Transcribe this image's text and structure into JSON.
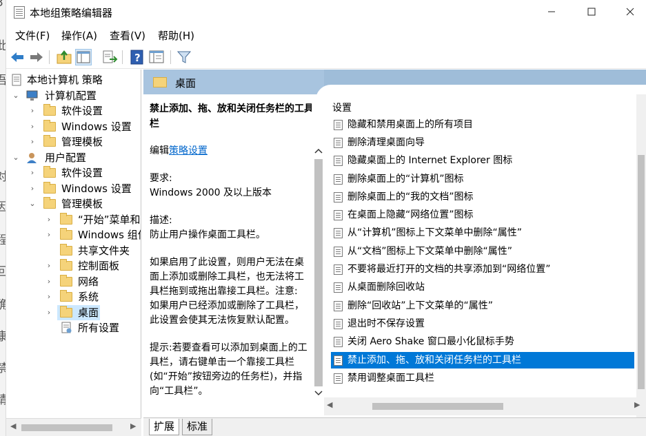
{
  "window": {
    "title": "本地组策略编辑器"
  },
  "menubar": [
    "文件(F)",
    "操作(A)",
    "查看(V)",
    "帮助(H)"
  ],
  "tree": [
    {
      "label": "本地计算机 策略",
      "chevron": ""
    },
    {
      "label": "计算机配置",
      "chevron": "⌄"
    },
    {
      "label": "软件设置",
      "chevron": "›"
    },
    {
      "label": "Windows 设置",
      "chevron": "›"
    },
    {
      "label": "管理模板",
      "chevron": "›"
    },
    {
      "label": "用户配置",
      "chevron": "⌄"
    },
    {
      "label": "软件设置",
      "chevron": "›"
    },
    {
      "label": "Windows 设置",
      "chevron": "›"
    },
    {
      "label": "管理模板",
      "chevron": "⌄"
    },
    {
      "label": "“开始”菜单和任",
      "chevron": "›"
    },
    {
      "label": "Windows 组件",
      "chevron": "›"
    },
    {
      "label": "共享文件夹",
      "chevron": ""
    },
    {
      "label": "控制面板",
      "chevron": "›"
    },
    {
      "label": "网络",
      "chevron": "›"
    },
    {
      "label": "系统",
      "chevron": "›"
    },
    {
      "label": "桌面",
      "chevron": "›"
    },
    {
      "label": "所有设置",
      "chevron": ""
    }
  ],
  "header": {
    "title": "桌面"
  },
  "description": {
    "title": "禁止添加、拖、放和关闭任务栏的工具栏",
    "edit_prefix": "编辑",
    "edit_link": "策略设置",
    "requirement_label": "要求:",
    "requirement_value": "Windows 2000 及以上版本",
    "desc_label": "描述:",
    "desc_value": "防止用户操作桌面工具栏。",
    "body": "如果启用了此设置，则用户无法在桌面上添加或删除工具栏，也无法将工具栏拖到或拖出靠接工具栏。注意: 如果用户已经添加或删除了工具栏，此设置会使其无法恢复默认配置。",
    "hint": "提示:若要查看可以添加到桌面上的工具栏，请右键单击一个靠接工具栏(如“开始”按钮旁边的任务栏)，并指向“工具栏”。"
  },
  "settings": {
    "column_header": "设置",
    "items": [
      "隐藏和禁用桌面上的所有项目",
      "删除清理桌面向导",
      "隐藏桌面上的 Internet Explorer 图标",
      "删除桌面上的“计算机”图标",
      "删除桌面上的“我的文档”图标",
      "在桌面上隐藏“网络位置”图标",
      "从“计算机”图标上下文菜单中删除“属性”",
      "从“文档”图标上下文菜单中删除“属性”",
      "不要将最近打开的文档的共享添加到“网络位置”",
      "从桌面删除回收站",
      "删除“回收站”上下文菜单的“属性”",
      "退出时不保存设置",
      "关闭 Aero Shake 窗口最小化鼠标手势",
      "禁止添加、拖、放和关闭任务栏的工具栏",
      "禁用调整桌面工具栏"
    ],
    "selected": "禁止添加、拖、放和关闭任务栏的工具栏"
  },
  "tabs": [
    "扩展",
    "标准"
  ],
  "background_chars": [
    "3",
    "此",
    "吾",
    "对",
    "因",
    "程",
    "回",
    "确",
    "康",
    "禁",
    "请"
  ]
}
